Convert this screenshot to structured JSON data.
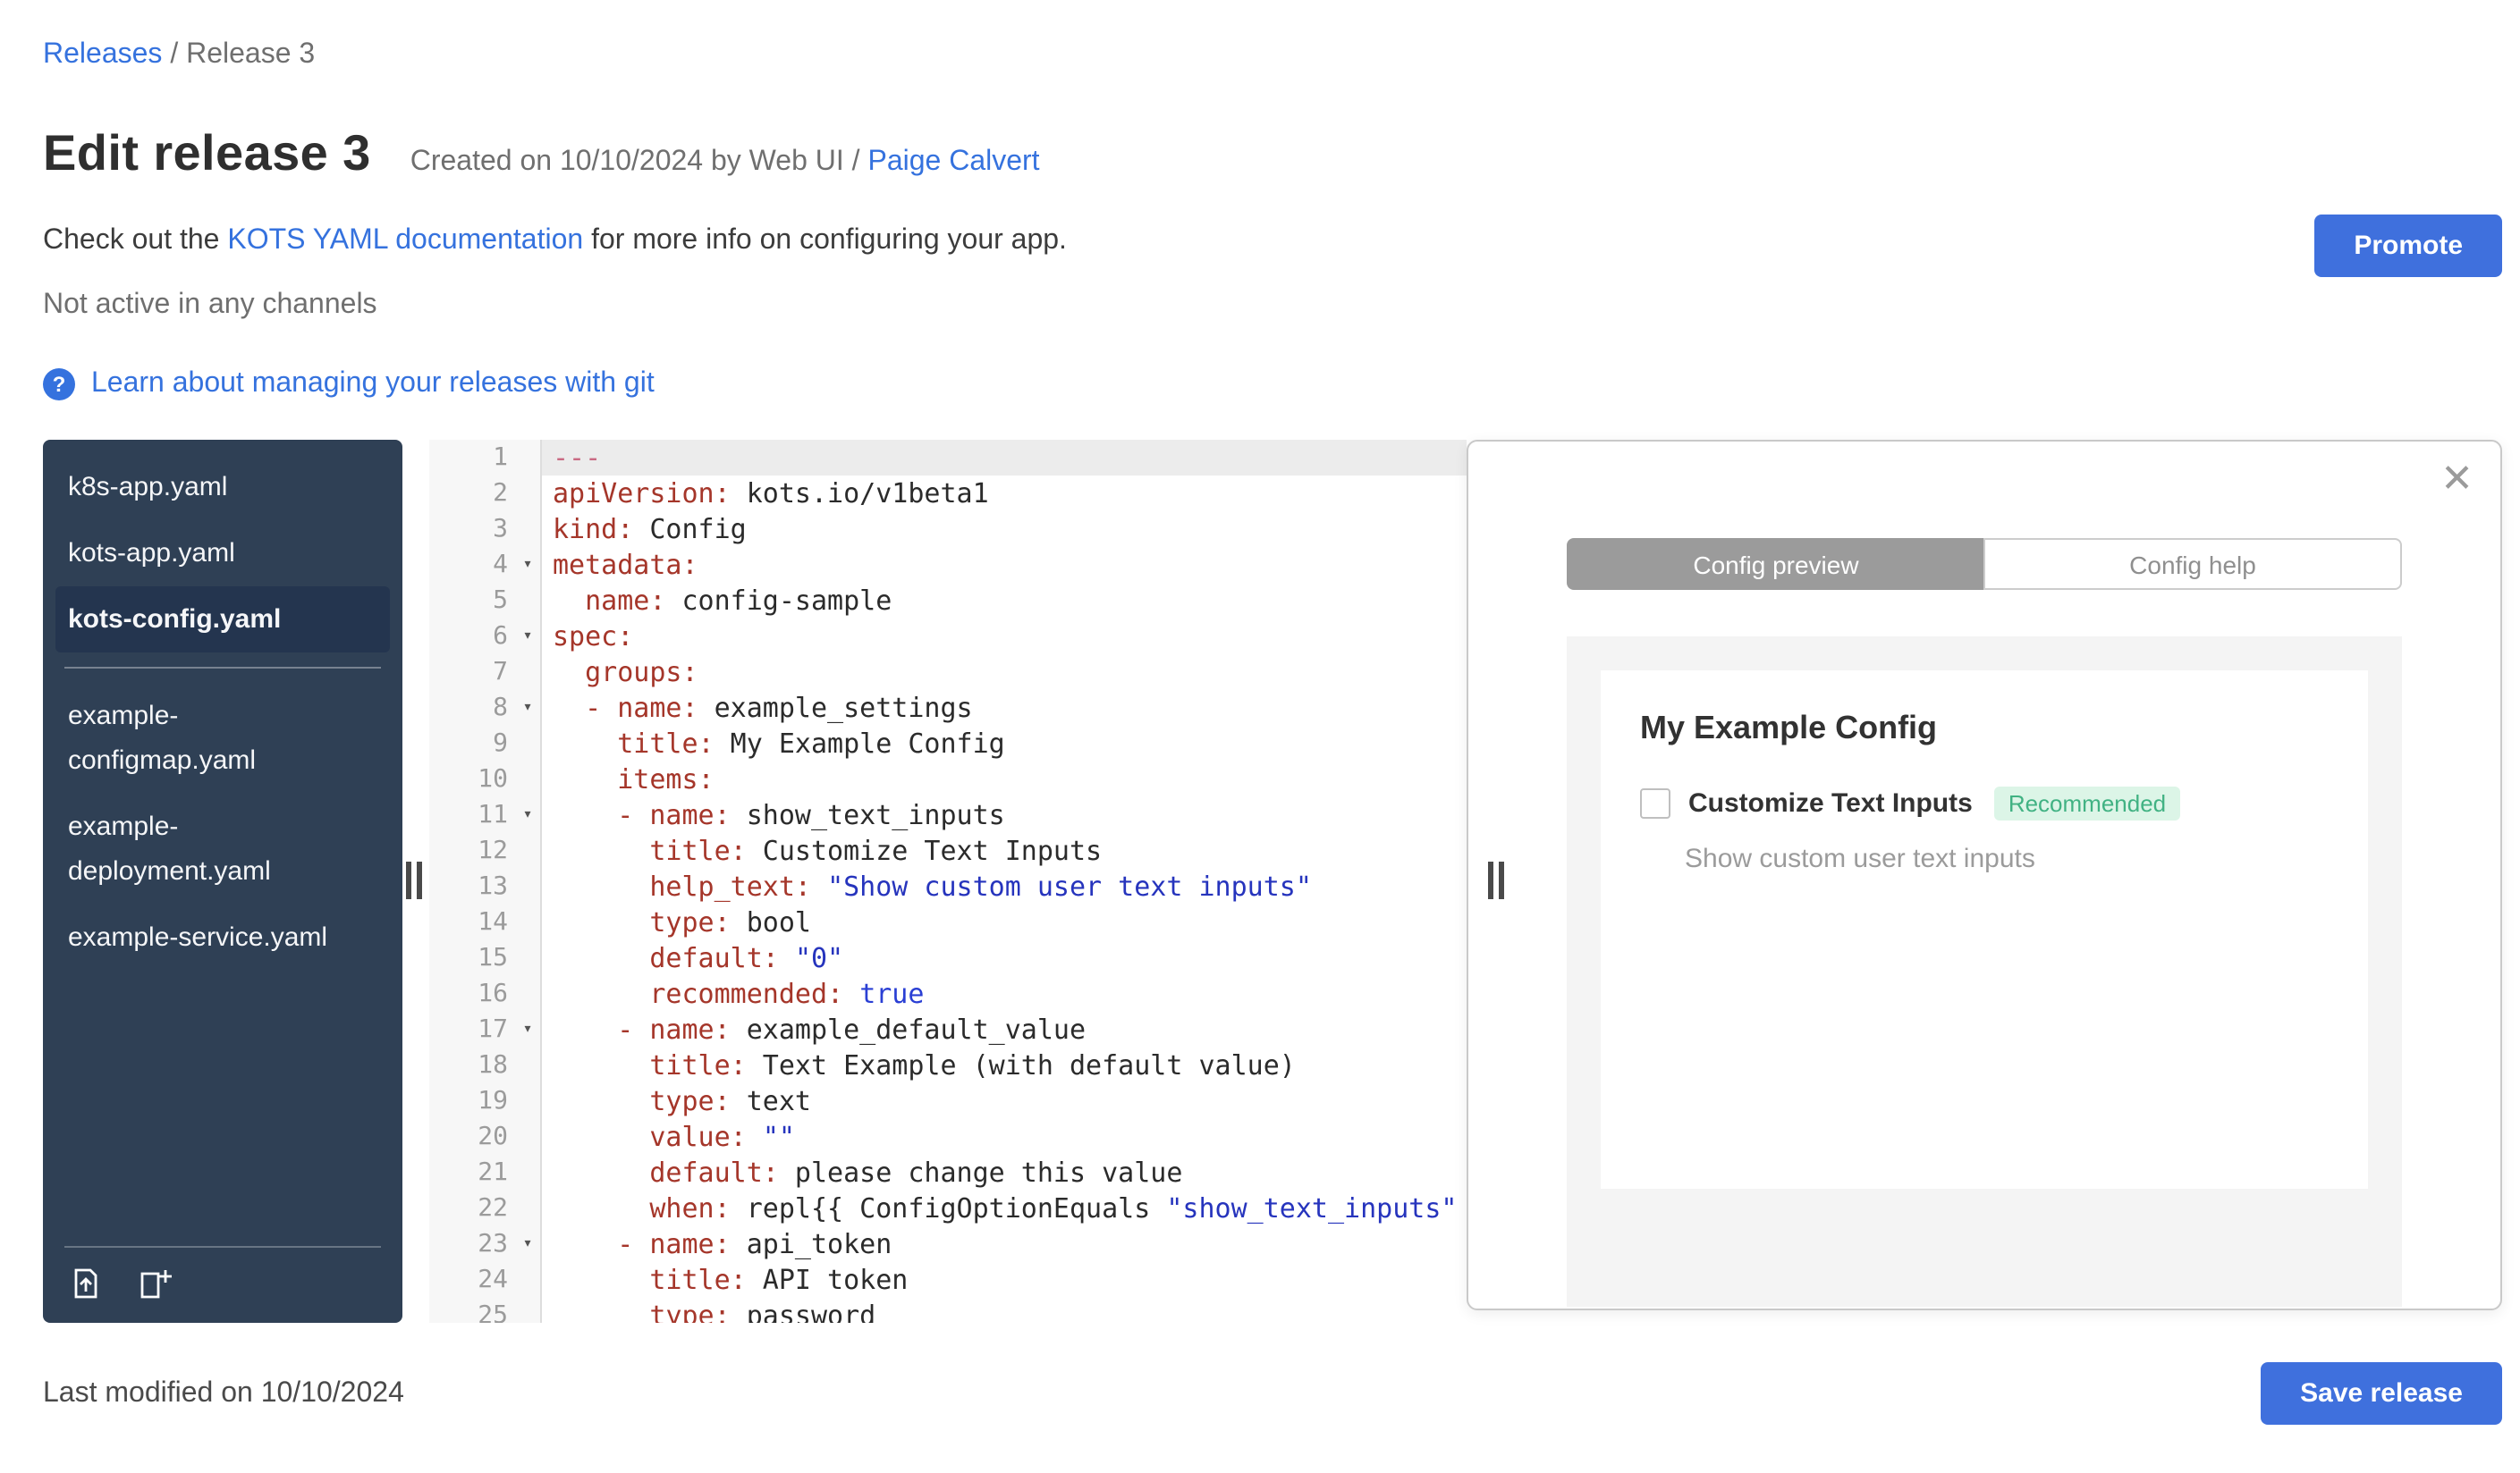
{
  "colors": {
    "link_blue": "#3572de",
    "button_blue": "#3f70dd",
    "sidebar_navy": "#2f4055",
    "badge_green_bg": "#dcf5e7",
    "badge_green_text": "#41b283"
  },
  "breadcrumb": {
    "releases": "Releases",
    "separator": "/",
    "current": "Release 3"
  },
  "header": {
    "title": "Edit release 3",
    "created_text": "Created on 10/10/2024 by Web UI /",
    "created_author": "Paige Calvert",
    "docs_prefix": "Check out the ",
    "docs_link": "KOTS YAML documentation",
    "docs_suffix": " for more info on configuring your app.",
    "channel_status": "Not active in any channels",
    "help_icon_glyph": "?",
    "git_link": "Learn about managing your releases with git",
    "promote_label": "Promote"
  },
  "file_tree": {
    "items": [
      {
        "label": "k8s-app.yaml",
        "selected": false
      },
      {
        "label": "kots-app.yaml",
        "selected": false
      },
      {
        "label": "kots-config.yaml",
        "selected": true,
        "divider_after": true
      },
      {
        "label": "example-configmap.yaml",
        "selected": false
      },
      {
        "label": "example-deployment.yaml",
        "selected": false
      },
      {
        "label": "example-service.yaml",
        "selected": false
      }
    ]
  },
  "editor": {
    "lines": [
      {
        "n": 1,
        "active": true,
        "fold": false,
        "t": [
          [
            "meta",
            "---"
          ]
        ]
      },
      {
        "n": 2,
        "fold": false,
        "t": [
          [
            "key",
            "apiVersion:"
          ],
          [
            "pl",
            " kots.io/v1beta1"
          ]
        ]
      },
      {
        "n": 3,
        "fold": false,
        "t": [
          [
            "key",
            "kind:"
          ],
          [
            "pl",
            " Config"
          ]
        ]
      },
      {
        "n": 4,
        "fold": true,
        "t": [
          [
            "key",
            "metadata:"
          ]
        ]
      },
      {
        "n": 5,
        "fold": false,
        "t": [
          [
            "pl",
            "  "
          ],
          [
            "key",
            "name:"
          ],
          [
            "pl",
            " config-sample"
          ]
        ]
      },
      {
        "n": 6,
        "fold": true,
        "t": [
          [
            "key",
            "spec:"
          ]
        ]
      },
      {
        "n": 7,
        "fold": false,
        "t": [
          [
            "pl",
            "  "
          ],
          [
            "key",
            "groups:"
          ]
        ]
      },
      {
        "n": 8,
        "fold": true,
        "t": [
          [
            "pl",
            "  "
          ],
          [
            "key",
            "- name:"
          ],
          [
            "pl",
            " example_settings"
          ]
        ]
      },
      {
        "n": 9,
        "fold": false,
        "t": [
          [
            "pl",
            "    "
          ],
          [
            "key",
            "title:"
          ],
          [
            "pl",
            " My Example Config"
          ]
        ]
      },
      {
        "n": 10,
        "fold": false,
        "t": [
          [
            "pl",
            "    "
          ],
          [
            "key",
            "items:"
          ]
        ]
      },
      {
        "n": 11,
        "fold": true,
        "t": [
          [
            "pl",
            "    "
          ],
          [
            "key",
            "- name:"
          ],
          [
            "pl",
            " show_text_inputs"
          ]
        ]
      },
      {
        "n": 12,
        "fold": false,
        "t": [
          [
            "pl",
            "      "
          ],
          [
            "key",
            "title:"
          ],
          [
            "pl",
            " Customize Text Inputs"
          ]
        ]
      },
      {
        "n": 13,
        "fold": false,
        "t": [
          [
            "pl",
            "      "
          ],
          [
            "key",
            "help_text:"
          ],
          [
            "pl",
            " "
          ],
          [
            "str",
            "\"Show custom user text inputs\""
          ]
        ]
      },
      {
        "n": 14,
        "fold": false,
        "t": [
          [
            "pl",
            "      "
          ],
          [
            "key",
            "type:"
          ],
          [
            "pl",
            " bool"
          ]
        ]
      },
      {
        "n": 15,
        "fold": false,
        "t": [
          [
            "pl",
            "      "
          ],
          [
            "key",
            "default:"
          ],
          [
            "pl",
            " "
          ],
          [
            "str",
            "\"0\""
          ]
        ]
      },
      {
        "n": 16,
        "fold": false,
        "t": [
          [
            "pl",
            "      "
          ],
          [
            "key",
            "recommended:"
          ],
          [
            "pl",
            " "
          ],
          [
            "atom",
            "true"
          ]
        ]
      },
      {
        "n": 17,
        "fold": true,
        "t": [
          [
            "pl",
            "    "
          ],
          [
            "key",
            "- name:"
          ],
          [
            "pl",
            " example_default_value"
          ]
        ]
      },
      {
        "n": 18,
        "fold": false,
        "t": [
          [
            "pl",
            "      "
          ],
          [
            "key",
            "title:"
          ],
          [
            "pl",
            " Text Example (with default value)"
          ]
        ]
      },
      {
        "n": 19,
        "fold": false,
        "t": [
          [
            "pl",
            "      "
          ],
          [
            "key",
            "type:"
          ],
          [
            "pl",
            " text"
          ]
        ]
      },
      {
        "n": 20,
        "fold": false,
        "t": [
          [
            "pl",
            "      "
          ],
          [
            "key",
            "value:"
          ],
          [
            "pl",
            " "
          ],
          [
            "str",
            "\"\""
          ]
        ]
      },
      {
        "n": 21,
        "fold": false,
        "t": [
          [
            "pl",
            "      "
          ],
          [
            "key",
            "default:"
          ],
          [
            "pl",
            " please change this value"
          ]
        ]
      },
      {
        "n": 22,
        "fold": false,
        "t": [
          [
            "pl",
            "      "
          ],
          [
            "key",
            "when:"
          ],
          [
            "pl",
            " repl{{ ConfigOptionEquals "
          ],
          [
            "str",
            "\"show_text_inputs\""
          ]
        ]
      },
      {
        "n": 23,
        "fold": true,
        "t": [
          [
            "pl",
            "    "
          ],
          [
            "key",
            "- name:"
          ],
          [
            "pl",
            " api_token"
          ]
        ]
      },
      {
        "n": 24,
        "fold": false,
        "t": [
          [
            "pl",
            "      "
          ],
          [
            "key",
            "title:"
          ],
          [
            "pl",
            " API token"
          ]
        ]
      },
      {
        "n": 25,
        "fold": false,
        "t": [
          [
            "pl",
            "      "
          ],
          [
            "key",
            "type:"
          ],
          [
            "pl",
            " password"
          ]
        ]
      }
    ]
  },
  "preview_panel": {
    "close_glyph": "✕",
    "tabs": [
      {
        "label": "Config preview",
        "active": true
      },
      {
        "label": "Config help",
        "active": false
      }
    ],
    "config": {
      "group_title": "My Example Config",
      "item_label": "Customize Text Inputs",
      "badge": "Recommended",
      "help_text": "Show custom user text inputs",
      "checkbox_checked": false
    }
  },
  "footer": {
    "last_modified": "Last modified on 10/10/2024",
    "save_label": "Save release"
  }
}
